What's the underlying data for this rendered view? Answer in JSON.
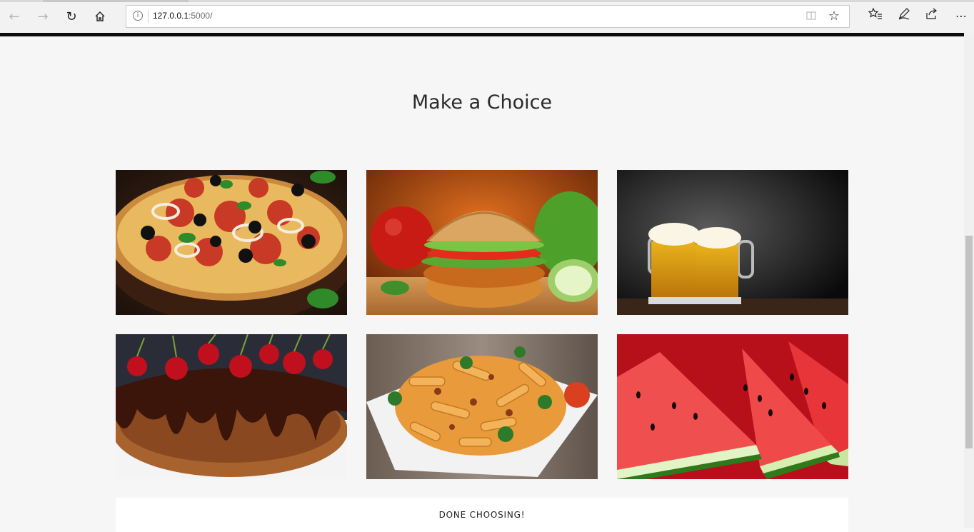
{
  "browser": {
    "url_host": "127.0.0.1",
    "url_rest": ":5000/",
    "icons": [
      "back-arrow-icon",
      "forward-arrow-icon",
      "refresh-icon",
      "home-icon",
      "site-info-icon",
      "reading-view-icon",
      "favorite-star-icon",
      "favorites-list-icon",
      "pen-notes-icon",
      "share-icon",
      "more-menu-icon"
    ]
  },
  "page": {
    "title": "Make a Choice",
    "done_label": "DONE CHOOSING!"
  },
  "choices": [
    {
      "name": "pizza"
    },
    {
      "name": "burger"
    },
    {
      "name": "beer"
    },
    {
      "name": "chocolate-cherry-cake"
    },
    {
      "name": "pasta"
    },
    {
      "name": "watermelon"
    }
  ],
  "colors": {
    "page_background": "#f6f6f6",
    "button_background": "#ffffff",
    "title_text": "#2b2b2b"
  }
}
